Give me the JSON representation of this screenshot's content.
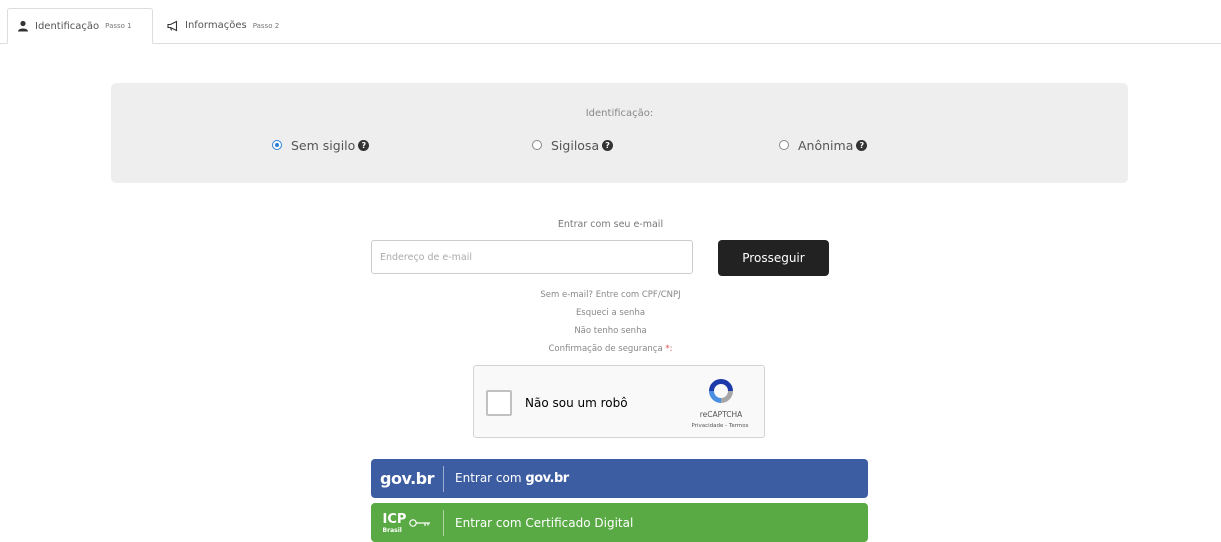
{
  "tabs": [
    {
      "label": "Identificação",
      "step": "Passo 1"
    },
    {
      "label": "Informações",
      "step": "Passo 2"
    }
  ],
  "identification": {
    "title": "Identificação:",
    "options": [
      {
        "label": "Sem sigilo",
        "checked": true
      },
      {
        "label": "Sigilosa",
        "checked": false
      },
      {
        "label": "Anônima",
        "checked": false
      }
    ]
  },
  "login": {
    "enter_label": "Entrar com seu e-mail",
    "email_placeholder": "Endereço de e-mail",
    "proceed_label": "Prosseguir",
    "no_email_link": "Sem e-mail? Entre com CPF/CNPJ",
    "forgot_password_link": "Esqueci a senha",
    "no_password_link": "Não tenho senha",
    "security_label": "Confirmação de segurança",
    "required_mark": "*:"
  },
  "captcha": {
    "text": "Não sou um robô",
    "brand": "reCAPTCHA",
    "privacy": "Privacidade",
    "terms": "Termos"
  },
  "govbr": {
    "logo": "gov.br",
    "text": "Entrar com",
    "text_brand": "gov.br"
  },
  "icp": {
    "logo_top": "ICP",
    "logo_bottom": "Brasil",
    "text": "Entrar com Certificado Digital"
  },
  "colors": {
    "govbr_blue": "#3c5da1",
    "icp_green": "#59aa45",
    "proceed_dark": "#222222",
    "radio_blue": "#2d82d6"
  }
}
